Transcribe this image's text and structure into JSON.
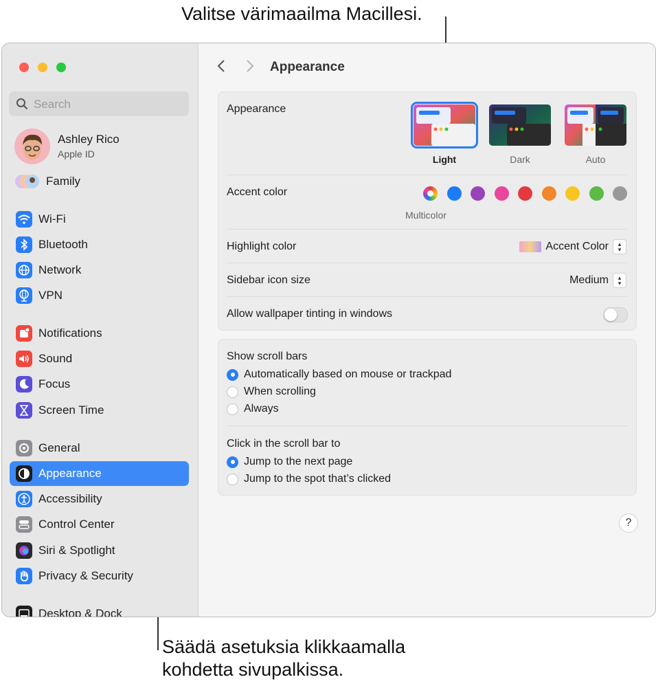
{
  "callouts": {
    "top": "Valitse värimaailma Macillesi.",
    "bottom_line1": "Säädä asetuksia klikkaamalla",
    "bottom_line2": "kohdetta sivupalkissa."
  },
  "sidebar": {
    "search_placeholder": "Search",
    "profile": {
      "name": "Ashley Rico",
      "subtitle": "Apple ID"
    },
    "family_label": "Family",
    "items": [
      {
        "label": "Wi-Fi",
        "icon": "wifi-icon",
        "color": "#2a7ef5"
      },
      {
        "label": "Bluetooth",
        "icon": "bluetooth-icon",
        "color": "#2a7ef5"
      },
      {
        "label": "Network",
        "icon": "globe-icon",
        "color": "#2a7ef5"
      },
      {
        "label": "VPN",
        "icon": "vpn-globe-icon",
        "color": "#2a7ef5"
      },
      {
        "label": "Notifications",
        "icon": "bell-icon",
        "color": "#f0483f"
      },
      {
        "label": "Sound",
        "icon": "speaker-icon",
        "color": "#f0483f"
      },
      {
        "label": "Focus",
        "icon": "moon-icon",
        "color": "#5b4fd6"
      },
      {
        "label": "Screen Time",
        "icon": "hourglass-icon",
        "color": "#5b4fd6"
      },
      {
        "label": "General",
        "icon": "gear-icon",
        "color": "#8e8e93"
      },
      {
        "label": "Appearance",
        "icon": "appearance-icon",
        "color": "#1d1d1f"
      },
      {
        "label": "Accessibility",
        "icon": "accessibility-icon",
        "color": "#2a7ef5"
      },
      {
        "label": "Control Center",
        "icon": "control-center-icon",
        "color": "#8e8e93"
      },
      {
        "label": "Siri & Spotlight",
        "icon": "siri-icon",
        "color": "#2b2b2b"
      },
      {
        "label": "Privacy & Security",
        "icon": "hand-icon",
        "color": "#2a7ef5"
      },
      {
        "label": "Desktop & Dock",
        "icon": "dock-icon",
        "color": "#1d1d1f"
      }
    ],
    "selected": "Appearance"
  },
  "header": {
    "title": "Appearance"
  },
  "appearance_panel": {
    "appearance_label": "Appearance",
    "modes": [
      "Light",
      "Dark",
      "Auto"
    ],
    "selected_mode": "Light",
    "accent_label": "Accent color",
    "accent_colors": [
      "#9b9b9b",
      "#1b7cf5",
      "#9a44b8",
      "#e8479b",
      "#e23a3f",
      "#f0872b",
      "#f7c423",
      "#5cba47",
      "#999999"
    ],
    "accent_selected_label": "Multicolor",
    "highlight_label": "Highlight color",
    "highlight_value": "Accent Color",
    "sidebar_icon_label": "Sidebar icon size",
    "sidebar_icon_value": "Medium",
    "tinting_label": "Allow wallpaper tinting in windows"
  },
  "scroll_panel": {
    "show_label": "Show scroll bars",
    "show_options": [
      "Automatically based on mouse or trackpad",
      "When scrolling",
      "Always"
    ],
    "show_selected": 0,
    "click_label": "Click in the scroll bar to",
    "click_options": [
      "Jump to the next page",
      "Jump to the spot that’s clicked"
    ],
    "click_selected": 0
  },
  "help_label": "?"
}
